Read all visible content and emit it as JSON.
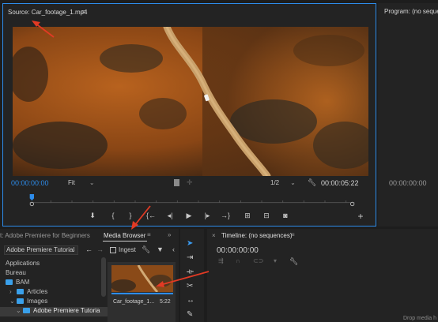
{
  "source": {
    "title": "Source: Car_footage_1.mp4",
    "menu_icon": "≡",
    "timecode_current": "00:00:00:00",
    "fit": "Fit",
    "resolution": "1/2",
    "duration": "00:00:05:22"
  },
  "program": {
    "title": "Program: (no sequences)",
    "timecode": "00:00:00:00"
  },
  "project": {
    "tab_inactive": "t: Adobe Premiere for Beginners",
    "tab_media_browser": "Media Browser",
    "tab_menu": "≡",
    "tab_more": "»",
    "path_dropdown": "Adobe Premiere Tutorial",
    "ingest_label": "Ingest",
    "tree": [
      {
        "label": "Applications"
      },
      {
        "label": "Bureau"
      },
      {
        "label": "BAM"
      },
      {
        "label": "Articles"
      },
      {
        "label": "Images"
      },
      {
        "label": "Adobe Premiere Tutoria"
      }
    ],
    "clip_name": "Car_footage_1...",
    "clip_duration": "5:22"
  },
  "timeline": {
    "close": "×",
    "title": "Timeline: (no sequences)",
    "menu_icon": "≡",
    "timecode": "00:00:00:00",
    "drop_text": "Drop media h"
  },
  "colors": {
    "accent_blue": "#2d8ceb",
    "annotation_red": "#e23a24"
  }
}
